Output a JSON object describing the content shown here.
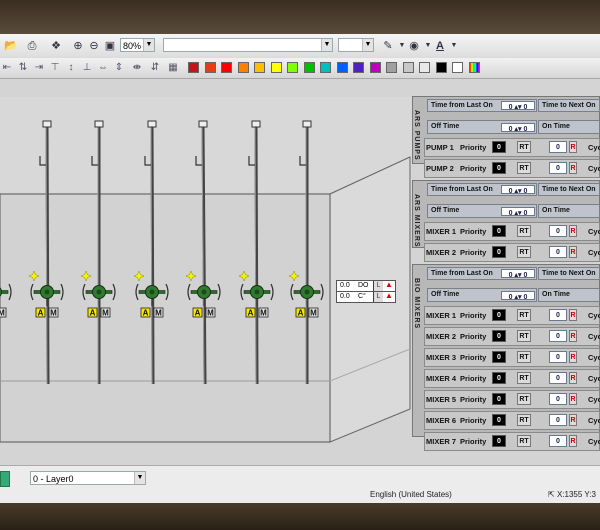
{
  "toolbar": {
    "zoom_value": "80%",
    "font_name": "",
    "font_size": "",
    "font_color_label": "A"
  },
  "palette": [
    "#c2161b",
    "#e63c18",
    "#ff0000",
    "#ff7f00",
    "#ffbf00",
    "#ffff00",
    "#7fff00",
    "#00c000",
    "#00bfbf",
    "#0060ff",
    "#5020c0",
    "#bf00bf",
    "#a0a0a0",
    "#c8c8c8",
    "#e8e8e8",
    "#000000",
    "#ffffff"
  ],
  "canvas": {
    "readouts": [
      {
        "value": "0.0",
        "unit": "DO",
        "flag": "L"
      },
      {
        "value": "0.0",
        "unit": "C°",
        "flag": "L"
      }
    ],
    "mixer_tags": {
      "auto": "A",
      "manual": "M"
    }
  },
  "panel": {
    "sections": [
      {
        "vlabel": "ARS PUMPS",
        "time_last": "Time from Last On",
        "time_next": "Time to Next On",
        "off_time": "Off Time",
        "on_time": "On Time",
        "units": [
          {
            "name": "PUMP 1",
            "priority_label": "Priority",
            "priority": "0",
            "rt": "RT",
            "value": "0",
            "flag": "R",
            "cyc": "Cyc"
          },
          {
            "name": "PUMP 2",
            "priority_label": "Priority",
            "priority": "0",
            "rt": "RT",
            "value": "0",
            "flag": "R",
            "cyc": "Cyc"
          }
        ]
      },
      {
        "vlabel": "ARS MIXERS",
        "time_last": "Time from Last On",
        "time_next": "Time to Next On",
        "off_time": "Off Time",
        "on_time": "On Time",
        "units": [
          {
            "name": "MIXER 1",
            "priority_label": "Priority",
            "priority": "0",
            "rt": "RT",
            "value": "0",
            "flag": "R",
            "cyc": "Cyc"
          },
          {
            "name": "MIXER 2",
            "priority_label": "Priority",
            "priority": "0",
            "rt": "RT",
            "value": "0",
            "flag": "R",
            "cyc": "Cyc"
          }
        ]
      },
      {
        "vlabel": "BIO MIXERS",
        "time_last": "Time from Last On",
        "time_next": "Time to Next On",
        "off_time": "Off Time",
        "on_time": "On Time",
        "units": [
          {
            "name": "MIXER 1",
            "priority_label": "Priority",
            "priority": "0",
            "rt": "RT",
            "value": "0",
            "flag": "R",
            "cyc": "Cyc"
          },
          {
            "name": "MIXER 2",
            "priority_label": "Priority",
            "priority": "0",
            "rt": "RT",
            "value": "0",
            "flag": "R",
            "cyc": "Cyc"
          },
          {
            "name": "MIXER 3",
            "priority_label": "Priority",
            "priority": "0",
            "rt": "RT",
            "value": "0",
            "flag": "R",
            "cyc": "Cyc"
          },
          {
            "name": "MIXER 4",
            "priority_label": "Priority",
            "priority": "0",
            "rt": "RT",
            "value": "0",
            "flag": "R",
            "cyc": "Cyc"
          },
          {
            "name": "MIXER 5",
            "priority_label": "Priority",
            "priority": "0",
            "rt": "RT",
            "value": "0",
            "flag": "R",
            "cyc": "Cyc"
          },
          {
            "name": "MIXER 6",
            "priority_label": "Priority",
            "priority": "0",
            "rt": "RT",
            "value": "0",
            "flag": "R",
            "cyc": "Cyc"
          },
          {
            "name": "MIXER 7",
            "priority_label": "Priority",
            "priority": "0",
            "rt": "RT",
            "value": "0",
            "flag": "R",
            "cyc": "Cyc"
          }
        ]
      }
    ]
  },
  "statusbar": {
    "layer_select": "0 - Layer0",
    "language": "English (United States)",
    "coords": "X:1355 Y:3"
  }
}
